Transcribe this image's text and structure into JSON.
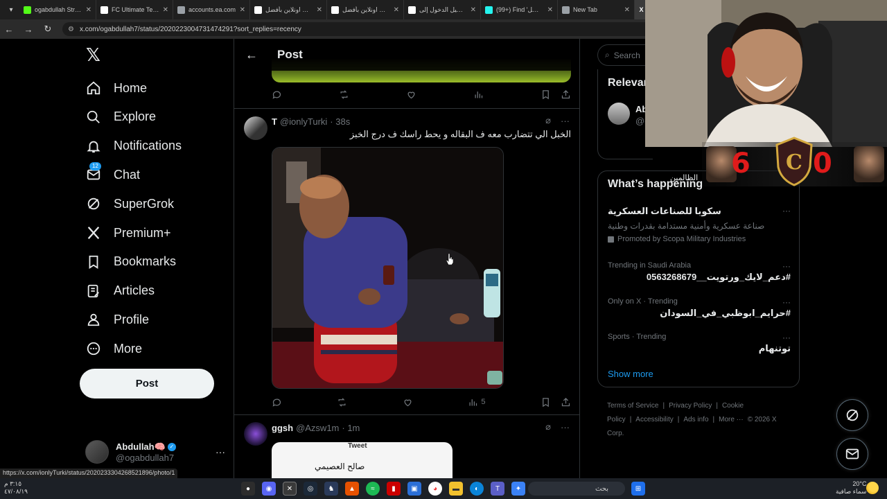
{
  "browser": {
    "tabs": [
      {
        "title": "ogabdullah Stream",
        "color": "#53fc18"
      },
      {
        "title": "FC Ultimate Team",
        "color": "#ffffff"
      },
      {
        "title": "accounts.ea.com",
        "color": "#9aa0a6"
      },
      {
        "title": "اشتري اونلاين بأفضل",
        "color": "#ffffff"
      },
      {
        "title": "اشتري اونلاين بأفضل",
        "color": "#ffffff"
      },
      {
        "title": "تسجيل الدخول إلى",
        "color": "#ffffff"
      },
      {
        "title": "(99+) Find 'التشل'",
        "color": "#25f4ee"
      },
      {
        "title": "New Tab",
        "color": "#9aa0a6"
      }
    ],
    "url": "x.com/ogabdullah7/status/2020223004731474291?sort_replies=recency",
    "status_url": "https://x.com/ionlyTurki/status/2020233304268521896/photo/1"
  },
  "sidebar": {
    "items": [
      {
        "label": "Home",
        "icon": "home-icon"
      },
      {
        "label": "Explore",
        "icon": "search-icon"
      },
      {
        "label": "Notifications",
        "icon": "bell-icon"
      },
      {
        "label": "Chat",
        "icon": "mail-icon",
        "badge": "12"
      },
      {
        "label": "SuperGrok",
        "icon": "grok-icon"
      },
      {
        "label": "Premium+",
        "icon": "x-icon"
      },
      {
        "label": "Bookmarks",
        "icon": "bookmark-icon"
      },
      {
        "label": "Articles",
        "icon": "articles-icon"
      },
      {
        "label": "Profile",
        "icon": "profile-icon"
      },
      {
        "label": "More",
        "icon": "more-icon"
      }
    ],
    "post_label": "Post",
    "account": {
      "name": "Abdullah🧠",
      "handle": "@ogabdullah7"
    }
  },
  "main": {
    "title": "Post",
    "tweet1": {
      "name": "T",
      "handle": "@ionlyTurki",
      "time": "· 38s",
      "text": "الخبل الي تتضارب معه ف البقاله و يحط راسك ف درج الخبز",
      "views": "5"
    },
    "tweet2": {
      "name": "ggsh",
      "handle": "@Azsw1m",
      "time": "· 1m",
      "media_header": "Tweet",
      "media_name": "صالح العصيمي"
    }
  },
  "right": {
    "search_placeholder": "Search",
    "relevant_title": "Relevant",
    "relevant_name": "Ab",
    "relevant_handle": "@o",
    "relevant_desc": "الظالمين",
    "happening_title": "What’s happening",
    "ad": {
      "title": "سكوبا للصناعات العسكرية",
      "desc": "صناعة عسكرية وأمنية مستدامة بقدرات وطنية",
      "promo": "Promoted by Scopa Military Industries"
    },
    "trends": [
      {
        "meta": "Trending in Saudi Arabia",
        "topic": "#دعم_لايك_ورتويت__0563268679"
      },
      {
        "meta": "Only on X · Trending",
        "topic": "#حرايم_ابوظبي_في_السودان"
      },
      {
        "meta": "Sports · Trending",
        "topic": "توتنهام"
      }
    ],
    "show_more": "Show more",
    "footer": [
      "Terms of Service",
      "|",
      "Privacy Policy",
      "|",
      "Cookie Policy",
      "|",
      "Accessibility",
      "|",
      "Ads info",
      "|",
      "More ···",
      "© 2026 X Corp."
    ]
  },
  "overlay": {
    "score_left": "6",
    "score_right": "0",
    "shield_letter": "C"
  },
  "taskbar": {
    "time_left": "٣:١٥ م",
    "date_left": "٤٧/٠٨/١٩",
    "search": "بحث",
    "temp": "20°C",
    "weather": "سماء صافية"
  }
}
